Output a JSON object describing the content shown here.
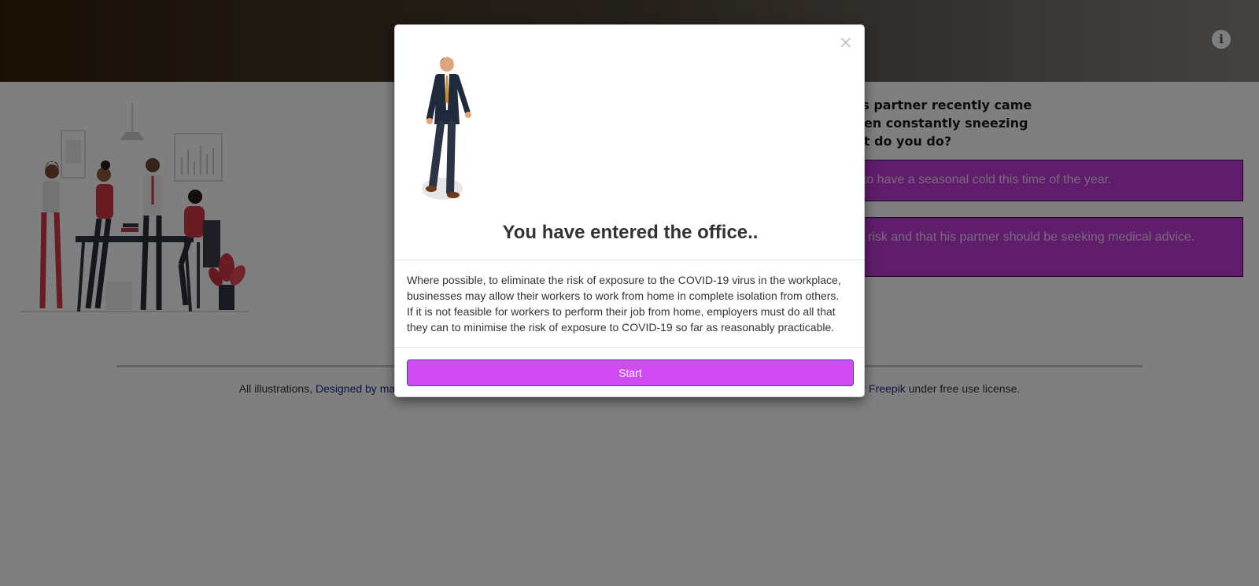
{
  "header": {
    "info_icon": "info-circle-icon"
  },
  "question": {
    "lines": [
      "you his partner recently came",
      "d is seen constantly sneezing",
      "y, what do you do?"
    ]
  },
  "answers": [
    "y natural to have a seasonal cold this time of the year.",
    "ger of the risk and that his partner should be seeking medical advice."
  ],
  "footer": {
    "prefix": "All illustrations, ",
    "link1": "Designed by mac",
    "link2": "y Freepik",
    "suffix": " under free use license."
  },
  "modal": {
    "close": "×",
    "title": "You have entered the office..",
    "body": "Where possible, to eliminate the risk of exposure to the COVID-19 virus in the workplace, businesses may allow their workers to work from home in complete isolation from others. If it is not feasible for workers to perform their job from home, employers must do all that they can to minimise the risk of exposure to COVID-19 so far as reasonably practicable.",
    "button": "Start"
  },
  "colors": {
    "accent": "#d24bf2",
    "answer_bg": "#c03ad8",
    "header_dark": "#34230c"
  }
}
